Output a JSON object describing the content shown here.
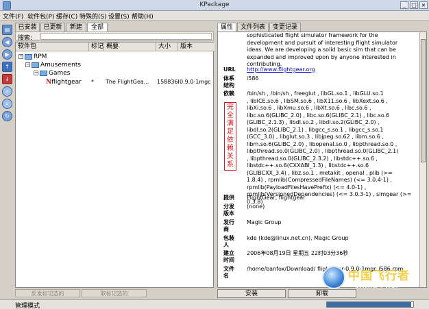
{
  "window": {
    "title": "KPackage"
  },
  "menu": [
    "文件(F)",
    "软件包(P)",
    "缓存(C)",
    "特殊的(S)",
    "设置(S)",
    "帮助(H)"
  ],
  "left_tabs": [
    "已安装",
    "已更新",
    "新建",
    "全部"
  ],
  "search": {
    "label": "搜索:",
    "value": ""
  },
  "list": {
    "columns": [
      "软件包",
      "标记",
      "概要",
      "大小",
      "版本"
    ],
    "tree": [
      {
        "label": "RPM",
        "expander": "−"
      },
      {
        "label": "Amusements",
        "expander": "−"
      },
      {
        "label": "Games",
        "expander": "−"
      }
    ],
    "row": {
      "name": "flightgear",
      "mark": "*",
      "summary": "The FlightGea...",
      "size": "158836K",
      "version": "0.9.0-1mgc"
    }
  },
  "bottom_buttons": [
    "反发标记选的",
    "取标记选的"
  ],
  "status": {
    "text": "管理模式",
    "progress_fraction": 0.98
  },
  "right_tabs": [
    "属性",
    "文件列表",
    "变更记录"
  ],
  "props": {
    "description": "sophisticated flight simulator framework for the\ndevelopment and pursuit of interesting flight simulator\nideas. We are developing a solid basic sim that can be\nexpanded and improved upon by anyone interested in\ncontributing.",
    "url_label": "URL",
    "url": "http://www.flightgear.org",
    "arch_label": "体系\n结构",
    "arch": "i586",
    "deps_label": "依赖",
    "deps": "/bin/sh , /bin/sh , freeglut , libGL.so.1 , libGLU.so.1\n, libICE.so.6 , libSM.so.6 , libX11.so.6 , libXext.so.6 ,\nlibXi.so.6 , libXmu.so.6 , libXt.so.6 , libc.so.6 ,\nlibc.so.6(GLIBC_2.0) , libc.so.6(GLIBC_2.1) , libc.so.6\n(GLIBC_2.1.3) , libdl.so.2 , libdl.so.2(GLIBC_2.0) ,\nlibdl.so.2(GLIBC_2.1) , libgcc_s.so.1 , libgcc_s.so.1\n(GCC_3.0) , libglut.so.3 , libjpeg.so.62 , libm.so.6 ,\nlibm.so.6(GLIBC_2.0) , libopenal.so.0 , libpthread.so.0 ,\nlibpthread.so.0(GLIBC_2.0) , libpthread.so.0(GLIBC_2.1)\n, libpthread.so.0(GLIBC_2.3.2) , libstdc++.so.6 ,\nlibstdc++.so.6(CXXABI_1.3) , libstdc++.so.6\n(GLIBCXX_3.4) , libz.so.1 , metakit , openal , plib (>=\n1.8.4) , rpmlib(CompressedFileNames) (<= 3.0.4-1) ,\nrpmlib(PayloadFilesHavePrefix) (<= 4.0-1) ,\nrpmlib(VersionedDependencies) (<= 3.0.3-1) , simgear (>=\n0.3.8)",
    "stamp": "完全满足依赖关系",
    "provides_label": "提供",
    "provides": "FlightGear, flightgear",
    "distro_label": "分发\n版本",
    "distro": "(none)",
    "vendor_label": "发行\n商",
    "vendor": "Magic Group",
    "packager_label": "包装\n人",
    "packager": "kde (kde@linux.net.cn), Magic Group",
    "build_label": "建立\n时间",
    "build": "2006年08月19日 星期五 22时03分36秒",
    "file_label": "文件\n名",
    "file": "/home/banfox/Download/ flightgear-0.9.0-1mgc.i586.rpm"
  },
  "actions": [
    "安装",
    "卸载"
  ],
  "watermark": {
    "text": "中国飞行者",
    "sub": "China Flier"
  }
}
